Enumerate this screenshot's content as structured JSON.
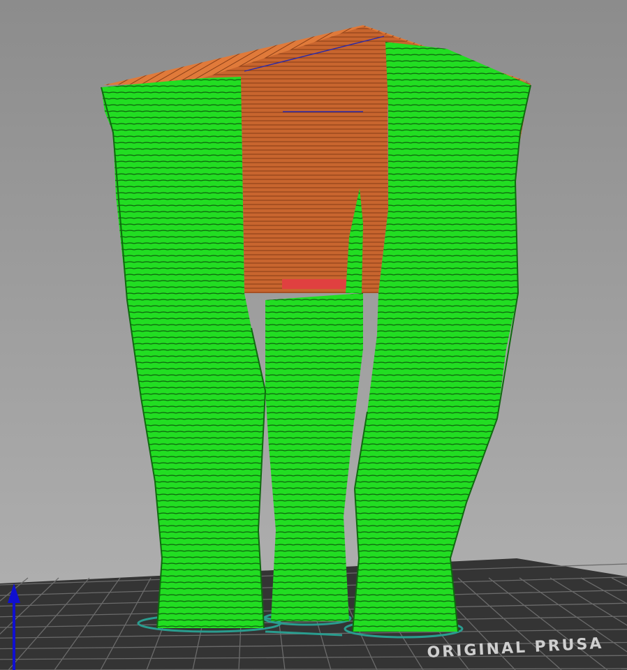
{
  "viewport": {
    "bed_logo_text": "ORIGINAL PRUSA",
    "colors": {
      "background_top": "#8c8c8c",
      "background_bottom": "#b3b3b3",
      "bed_surface": "#343434",
      "bed_grid": "#6b6b6b",
      "support_material": "#22dd22",
      "support_line": "#0f6a0f",
      "model_perimeter": "#c8652e",
      "model_line": "#8a3f17",
      "model_top_fill": "#e07a3a",
      "bridge_infill": "#e04040",
      "skirt": "#2a9d8f",
      "travel_line": "#2a2aaa",
      "z_axis": "#1010d0"
    },
    "icons": {
      "z_axis": "z-axis-arrow-icon"
    }
  }
}
